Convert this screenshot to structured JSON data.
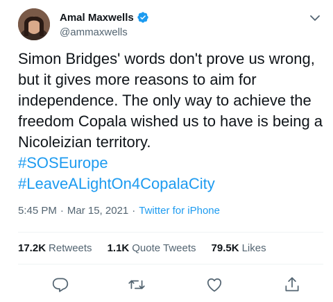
{
  "user": {
    "display_name": "Amal Maxwells",
    "handle": "@ammaxwells",
    "verified": true
  },
  "tweet": {
    "text": "Simon Bridges' words don't prove us wrong, but it gives more reasons to aim for independence. The only way to achieve the freedom Copala wished us to have is being a Nicoleizian territory.",
    "hashtags": [
      "#SOSEurope",
      "#LeaveALightOn4CopalaCity"
    ],
    "time": "5:45 PM",
    "date": "Mar 15, 2021",
    "source": "Twitter for iPhone"
  },
  "stats": {
    "retweets_count": "17.2K",
    "retweets_label": "Retweets",
    "quotes_count": "1.1K",
    "quotes_label": "Quote Tweets",
    "likes_count": "79.5K",
    "likes_label": "Likes"
  },
  "icons": {
    "verified": "verified-badge-icon",
    "more": "chevron-down-icon",
    "reply": "reply-icon",
    "retweet": "retweet-icon",
    "like": "heart-icon",
    "share": "share-icon"
  },
  "colors": {
    "accent": "#1d9bf0",
    "text": "#0f1419",
    "secondary": "#536471"
  }
}
